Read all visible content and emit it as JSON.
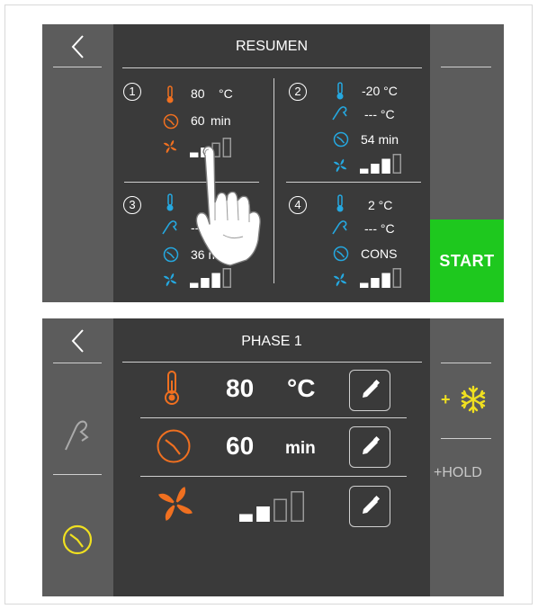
{
  "top_screen": {
    "title": "RESUMEN",
    "start_label": "START",
    "phases": [
      {
        "number": "1",
        "temp": "80",
        "temp_unit": "°C",
        "time": "60",
        "time_unit": "min",
        "fan_level": 2
      },
      {
        "number": "2",
        "temp": "-20 °C",
        "probe": "--- °C",
        "time": "54 min",
        "fan_level": 3
      },
      {
        "number": "3",
        "probe": "---",
        "time": "36 mi",
        "fan_level": 3
      },
      {
        "number": "4",
        "temp": "2 °C",
        "probe": "--- °C",
        "time": "CONS",
        "fan_level": 3
      }
    ]
  },
  "bottom_screen": {
    "title": "PHASE 1",
    "temp_value": "80",
    "temp_unit": "°C",
    "time_value": "60",
    "time_unit": "min",
    "fan_level": 2,
    "plus_label": "+",
    "hold_label": "+HOLD"
  },
  "colors": {
    "panel": "#3a3a3a",
    "side": "#5c5c5c",
    "hot": "#f07020",
    "cold": "#25a8e0",
    "start": "#1ec81e",
    "accent_yellow": "#f0e020"
  },
  "icons": [
    "back-icon",
    "thermometer-icon",
    "timer-icon",
    "fan-icon",
    "probe-icon",
    "snowflake-icon",
    "pencil-icon",
    "hand-pointer-icon"
  ]
}
